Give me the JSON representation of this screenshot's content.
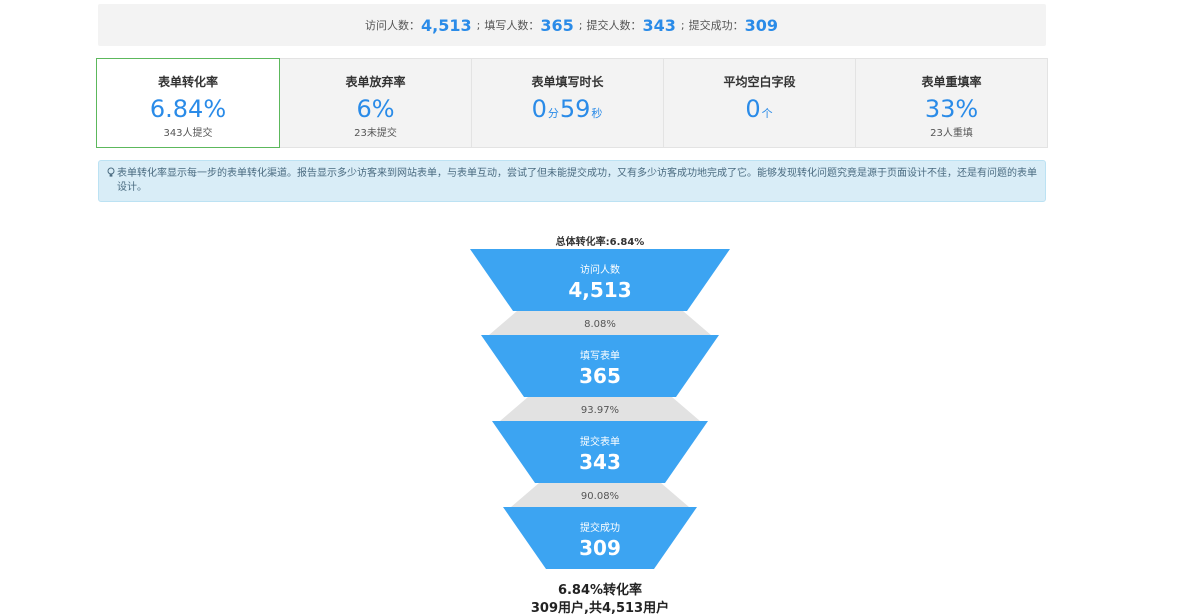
{
  "summary": {
    "visits_label": "访问人数：",
    "visits": "4,513",
    "fill_label": "填写人数：",
    "fill": "365",
    "submit_label": "提交人数：",
    "submit": "343",
    "success_label": "提交成功：",
    "success": "309",
    "sep": ";"
  },
  "kpis": [
    {
      "title": "表单转化率",
      "value": "6.84%",
      "sub": "343人提交"
    },
    {
      "title": "表单放弃率",
      "value": "6%",
      "sub": "23未提交"
    },
    {
      "title": "表单填写时长",
      "value_min": "0",
      "min_unit": "分",
      "value_sec": "59",
      "sec_unit": "秒"
    },
    {
      "title": "平均空白字段",
      "value": "0",
      "unit": "个"
    },
    {
      "title": "表单重填率",
      "value": "33%",
      "sub": "23人重填"
    }
  ],
  "info": {
    "icon": "lightbulb-icon",
    "text": "表单转化率显示每一步的表单转化渠道。报告显示多少访客来到网站表单，与表单互动，尝试了但未能提交成功，又有多少访客成功地完成了它。能够发现转化问题究竟是源于页面设计不佳，还是有问题的表单设计。"
  },
  "chart_data": {
    "type": "funnel",
    "title": "总体转化率:6.84%",
    "stages": [
      {
        "label": "访问人数",
        "value": 4513,
        "display": "4,513"
      },
      {
        "label": "填写表单",
        "value": 365,
        "display": "365"
      },
      {
        "label": "提交表单",
        "value": 343,
        "display": "343"
      },
      {
        "label": "提交成功",
        "value": 309,
        "display": "309"
      }
    ],
    "conversions": [
      "8.08%",
      "93.97%",
      "90.08%"
    ],
    "colors": {
      "stage": "#3ca4f2",
      "connector": "#e2e2e2"
    }
  },
  "result": {
    "line1": "6.84%转化率",
    "line2": "309用户,共4,513用户"
  }
}
